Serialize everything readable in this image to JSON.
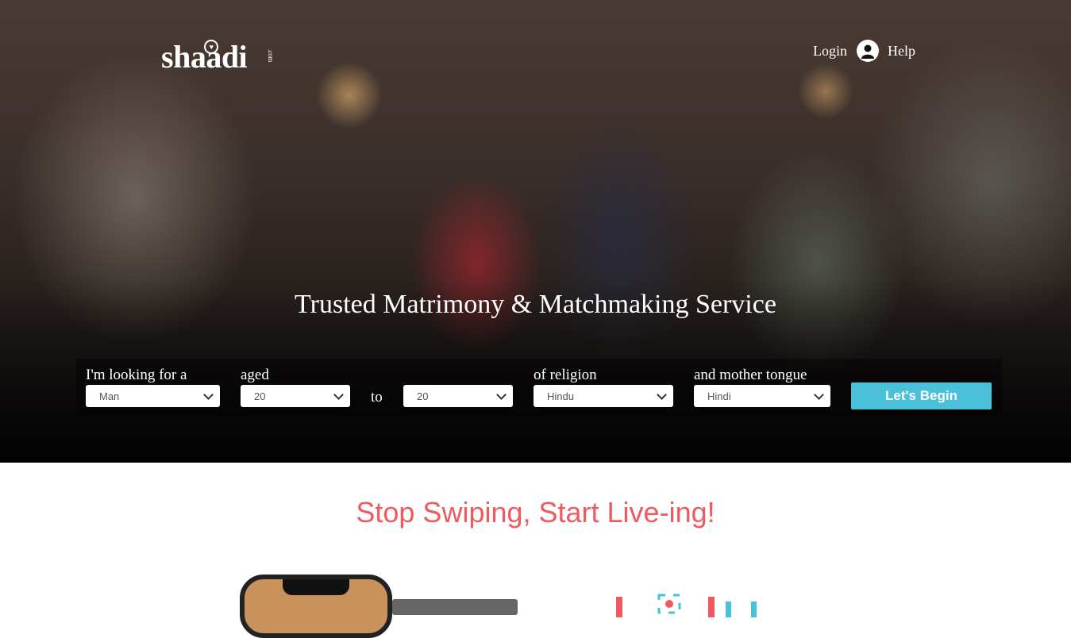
{
  "header": {
    "logo_text": "shaadi",
    "logo_suffix": ".com",
    "login_label": "Login",
    "help_label": "Help",
    "avatar_icon": "user-avatar-icon"
  },
  "hero": {
    "tagline": "Trusted Matrimony & Matchmaking Service"
  },
  "search": {
    "looking_for_label": "I'm looking for a",
    "looking_for_value": "Man",
    "aged_label": "aged",
    "age_from_value": "20",
    "to_label": "to",
    "age_to_value": "20",
    "religion_label": "of religion",
    "religion_value": "Hindu",
    "tongue_label": "and mother tongue",
    "tongue_value": "Hindi",
    "submit_label": "Let's Begin"
  },
  "promo": {
    "headline": "Stop Swiping, Start Live-ing!"
  },
  "colors": {
    "accent": "#4bc0d9",
    "headline": "#f05a5f"
  }
}
